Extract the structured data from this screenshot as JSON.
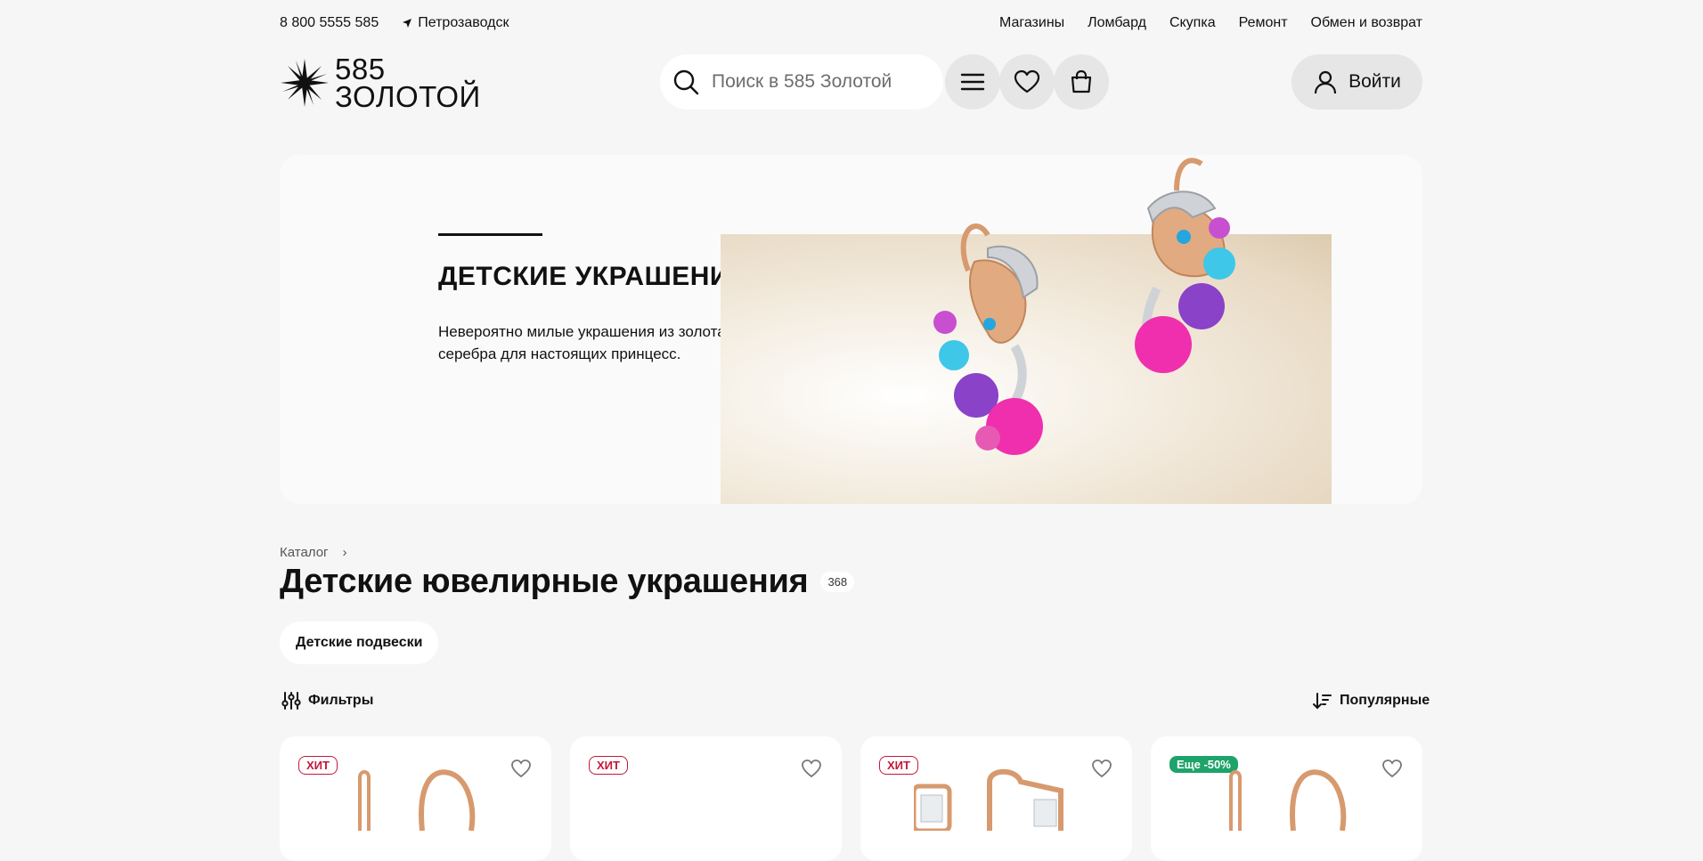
{
  "topbar": {
    "phone": "8 800 5555 585",
    "city": "Петрозаводск",
    "nav": [
      "Магазины",
      "Ломбард",
      "Скупка",
      "Ремонт",
      "Обмен и возврат"
    ]
  },
  "header": {
    "logo_line1": "585",
    "logo_line2": "ЗОЛОТОЙ",
    "search_placeholder": "Поиск в 585 Золотой",
    "login_label": "Войти"
  },
  "banner": {
    "title": "ДЕТСКИЕ УКРАШЕНИЯ",
    "text": "Невероятно милые украшения из золота и серебра для настоящих принцесс."
  },
  "catalog": {
    "breadcrumb": "Каталог",
    "title": "Детские ювелирные украшения",
    "count": "368",
    "chip": "Детские подвески",
    "filters_label": "Фильтры",
    "sort_label": "Популярные"
  },
  "products": [
    {
      "badge": "ХИТ",
      "badge_type": "hit"
    },
    {
      "badge": "ХИТ",
      "badge_type": "hit"
    },
    {
      "badge": "ХИТ",
      "badge_type": "hit"
    },
    {
      "badge": "Еще -50%",
      "badge_type": "sale"
    }
  ],
  "colors": {
    "background": "#f6f6f6",
    "hit_badge": "#c6163a",
    "sale_badge": "#1ea36b",
    "button_grey": "#e6e6e6",
    "rose_gold": "#d79a6e"
  }
}
